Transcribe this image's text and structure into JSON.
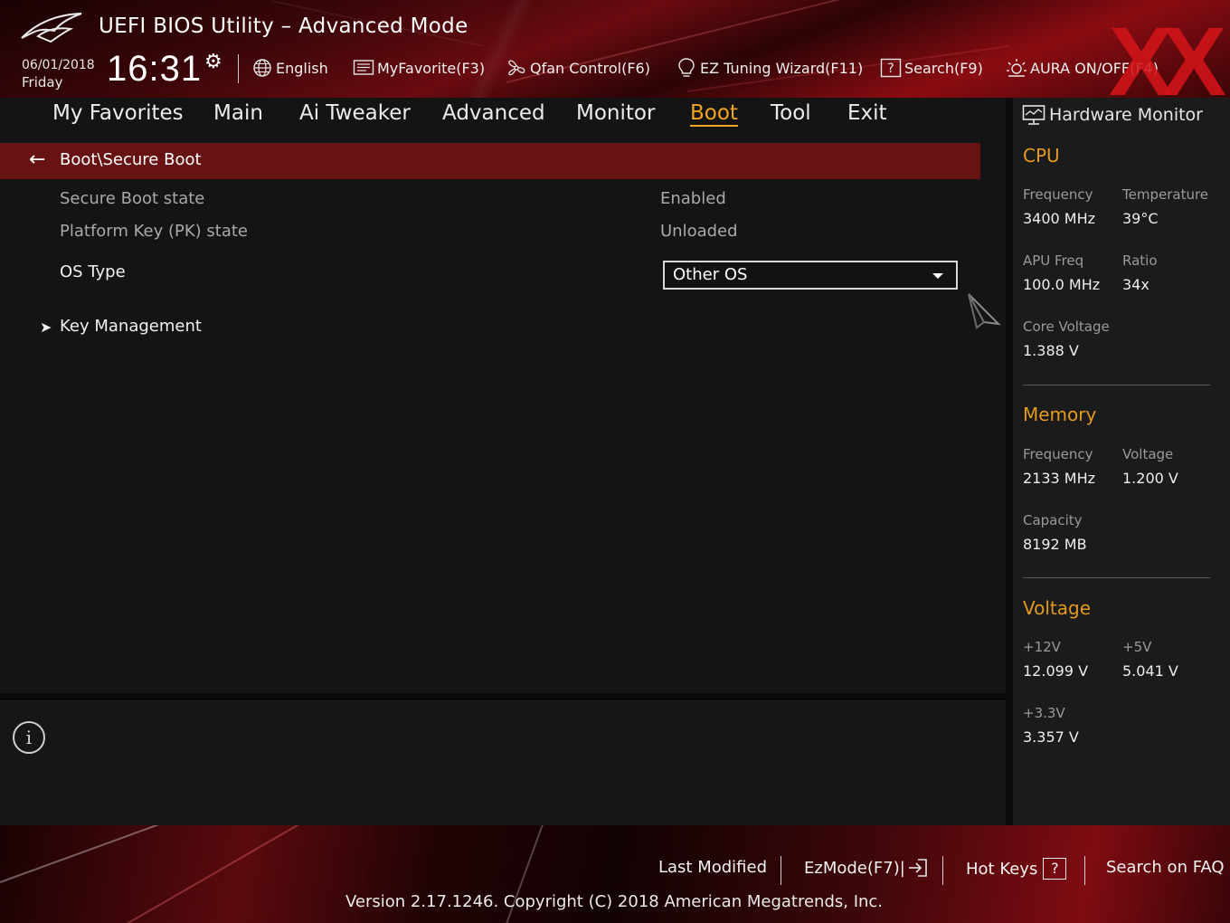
{
  "app": {
    "title": "UEFI BIOS Utility – Advanced Mode",
    "date": "06/01/2018",
    "day": "Friday",
    "time": "16:31"
  },
  "toolbar": {
    "language": "English",
    "myfavorite": "MyFavorite(F3)",
    "qfan": "Qfan Control(F6)",
    "ez_tuning": "EZ Tuning Wizard(F11)",
    "search": "Search(F9)",
    "aura": "AURA ON/OFF(F4)",
    "watermark": "XX"
  },
  "tabs": [
    {
      "label": "My Favorites"
    },
    {
      "label": "Main"
    },
    {
      "label": "Ai Tweaker"
    },
    {
      "label": "Advanced"
    },
    {
      "label": "Monitor"
    },
    {
      "label": "Boot",
      "active": true
    },
    {
      "label": "Tool"
    },
    {
      "label": "Exit"
    }
  ],
  "page": {
    "breadcrumb": "Boot\\Secure Boot",
    "rows": {
      "secure_boot_state": {
        "label": "Secure Boot state",
        "value": "Enabled"
      },
      "pk_state": {
        "label": "Platform Key (PK) state",
        "value": "Unloaded"
      },
      "os_type": {
        "label": "OS Type",
        "value": "Other OS"
      },
      "key_management": {
        "label": "Key Management"
      }
    }
  },
  "hardware_monitor": {
    "title": "Hardware Monitor",
    "cpu": {
      "heading": "CPU",
      "frequency_label": "Frequency",
      "frequency": "3400 MHz",
      "temperature_label": "Temperature",
      "temperature": "39°C",
      "apu_freq_label": "APU Freq",
      "apu_freq": "100.0 MHz",
      "ratio_label": "Ratio",
      "ratio": "34x",
      "core_voltage_label": "Core Voltage",
      "core_voltage": "1.388 V"
    },
    "memory": {
      "heading": "Memory",
      "frequency_label": "Frequency",
      "frequency": "2133 MHz",
      "voltage_label": "Voltage",
      "voltage": "1.200 V",
      "capacity_label": "Capacity",
      "capacity": "8192 MB"
    },
    "voltage": {
      "heading": "Voltage",
      "v12_label": "+12V",
      "v12": "12.099 V",
      "v5_label": "+5V",
      "v5": "5.041 V",
      "v33_label": "+3.3V",
      "v33": "3.357 V"
    }
  },
  "footer": {
    "last_modified": "Last Modified",
    "ezmode": "EzMode(F7)|",
    "hotkeys": "Hot Keys",
    "hotkeys_key": "?",
    "search_faq": "Search on FAQ",
    "version": "Version 2.17.1246. Copyright (C) 2018 American Megatrends, Inc."
  },
  "colors": {
    "accent_orange": "#f2a520",
    "breadcrumb_red": "#671314",
    "header_red": "#8a0c12",
    "watermark_red": "#d21419"
  }
}
